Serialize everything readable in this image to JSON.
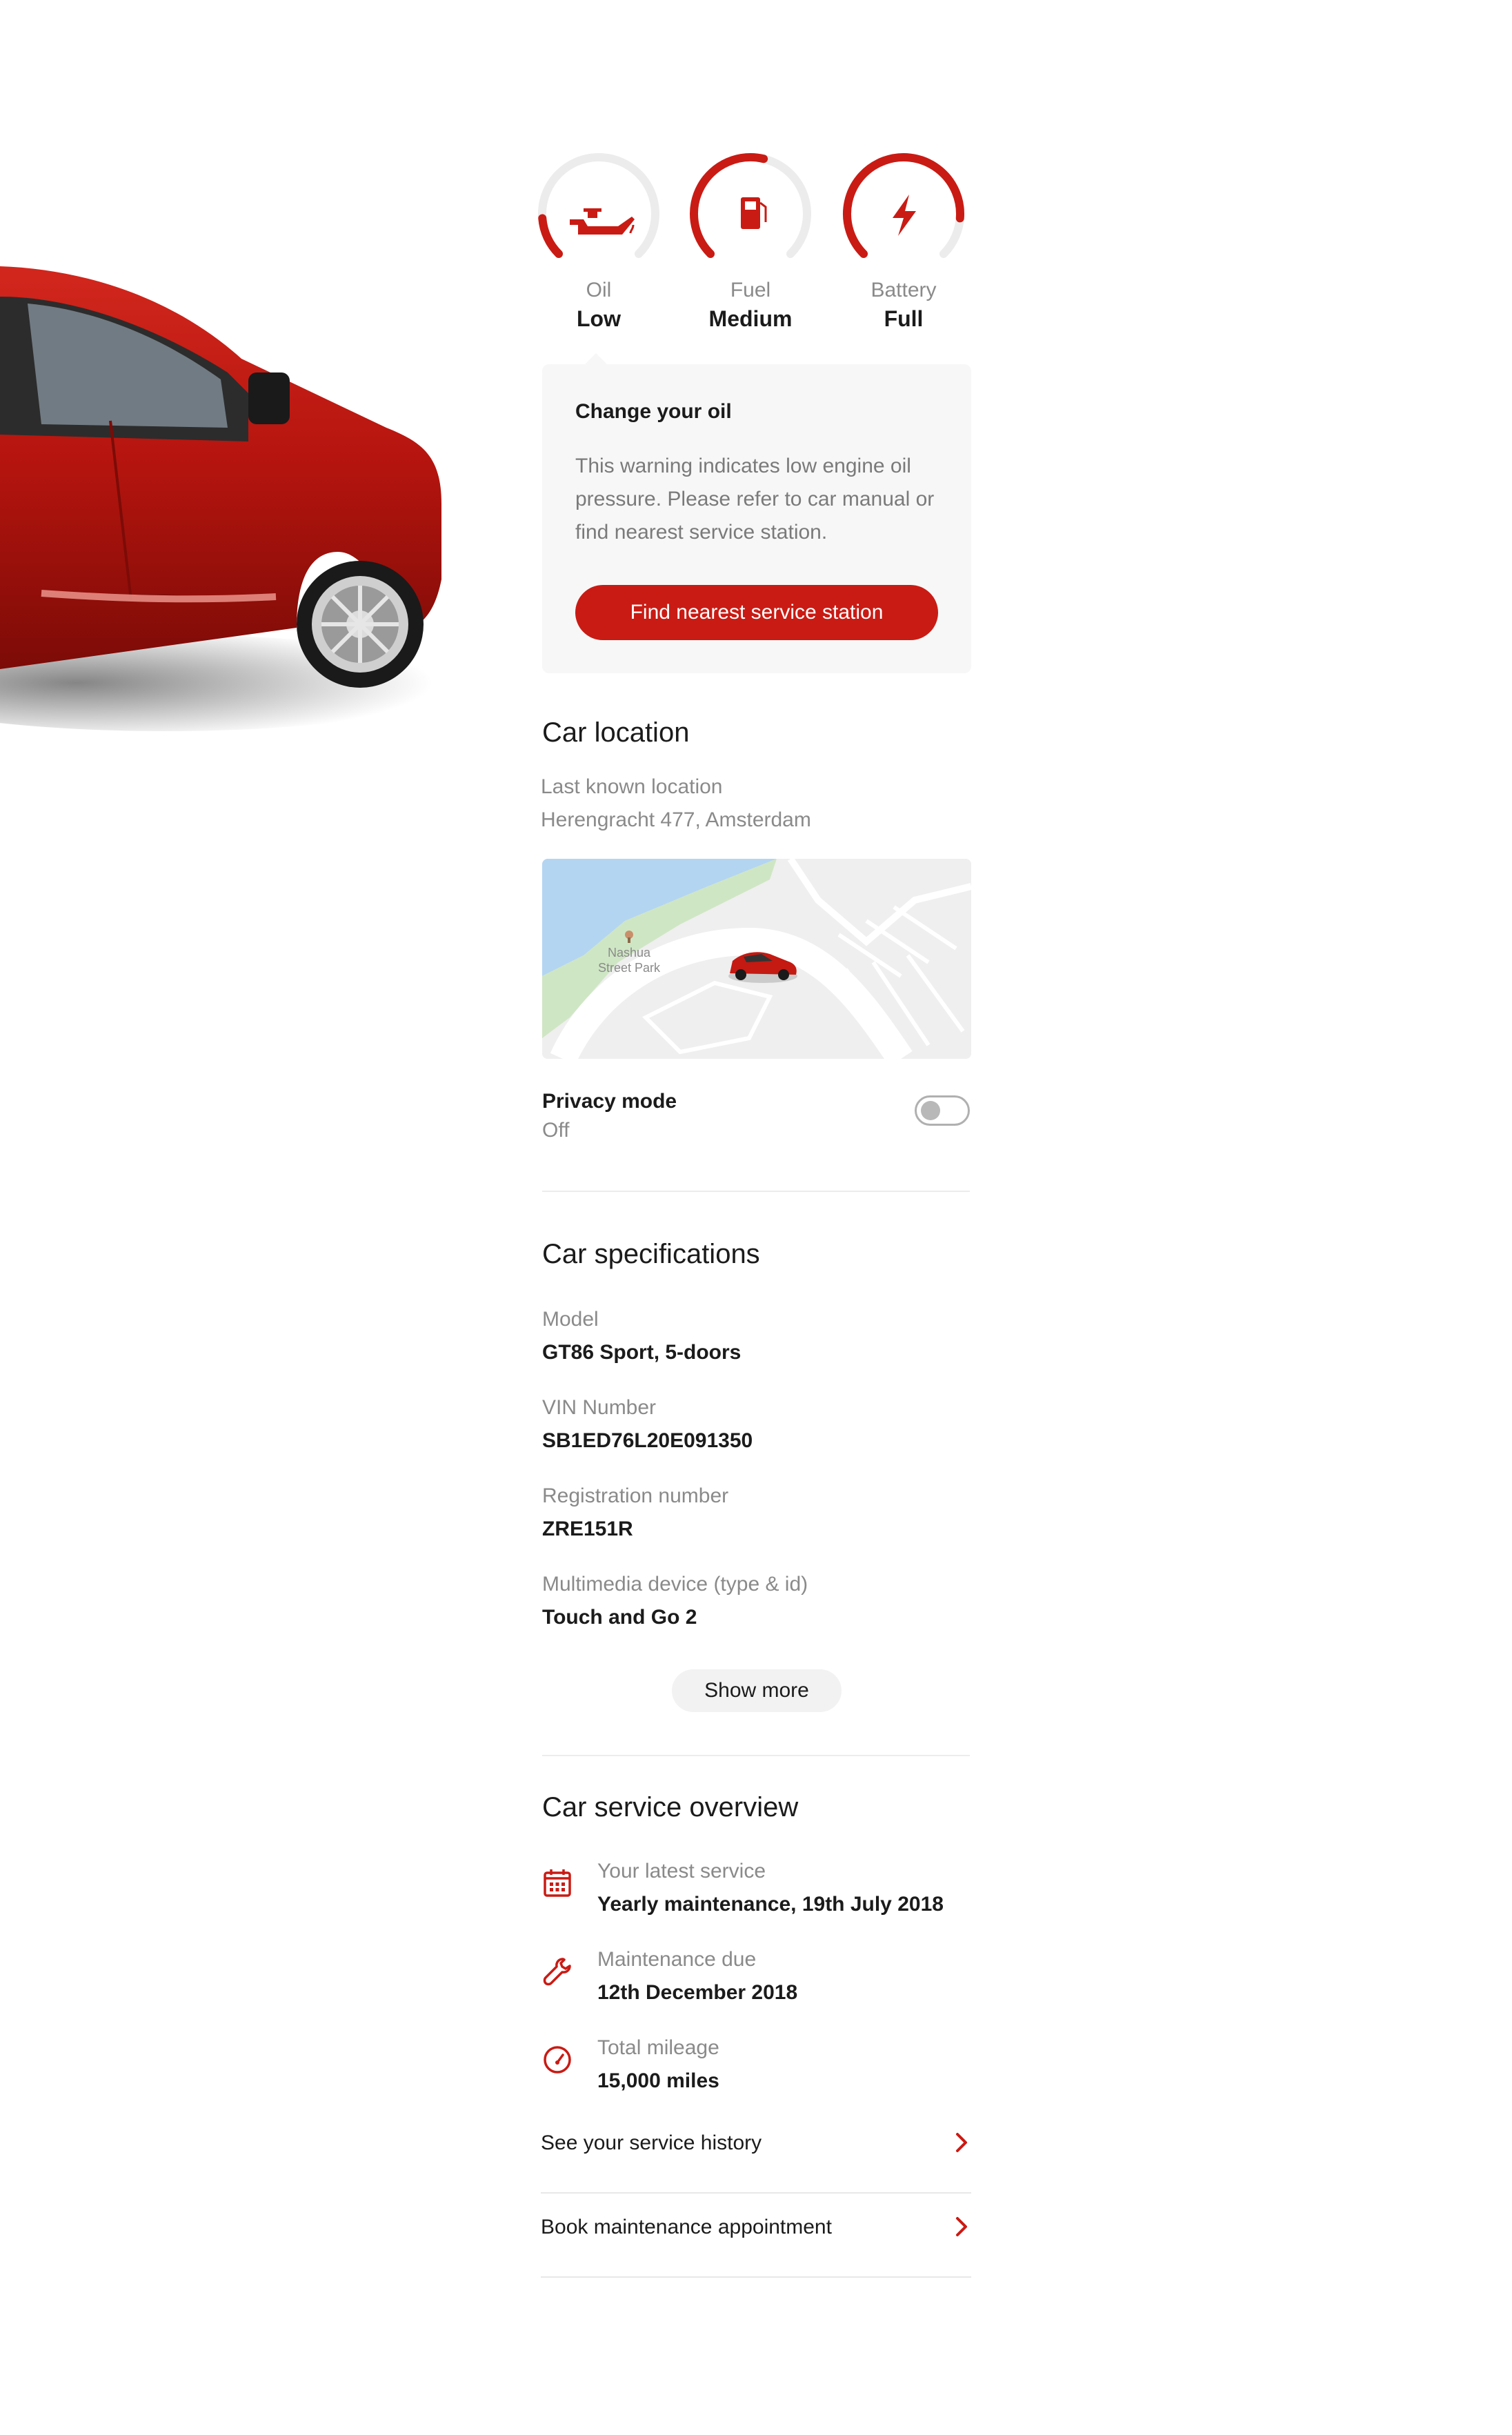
{
  "gauges": [
    {
      "id": "oil",
      "label": "Oil",
      "value": "Low",
      "level": 0.15,
      "icon": "oil-can-icon"
    },
    {
      "id": "fuel",
      "label": "Fuel",
      "value": "Medium",
      "level": 0.55,
      "icon": "fuel-pump-icon"
    },
    {
      "id": "battery",
      "label": "Battery",
      "value": "Full",
      "level": 0.85,
      "icon": "lightning-bolt-icon"
    }
  ],
  "warning": {
    "title": "Change your oil",
    "body": "This warning indicates low engine oil pressure. Please refer to car manual or find nearest service station.",
    "cta": "Find nearest service station"
  },
  "location": {
    "title": "Car location",
    "caption": "Last known location",
    "address": "Herengracht 477, Amsterdam",
    "map_label_line1": "Nashua",
    "map_label_line2": "Street Park"
  },
  "privacy": {
    "label": "Privacy mode",
    "state": "Off",
    "enabled": false
  },
  "specs": {
    "title": "Car specifications",
    "items": [
      {
        "label": "Model",
        "value": "GT86 Sport, 5-doors"
      },
      {
        "label": "VIN Number",
        "value": "SB1ED76L20E091350"
      },
      {
        "label": "Registration number",
        "value": "ZRE151R"
      },
      {
        "label": "Multimedia device (type & id)",
        "value": "Touch and Go 2"
      }
    ],
    "show_more": "Show more"
  },
  "service": {
    "title": "Car service overview",
    "items": [
      {
        "label": "Your latest service",
        "value": "Yearly maintenance, 19th July 2018",
        "icon": "calendar-icon"
      },
      {
        "label": "Maintenance due",
        "value": "12th December 2018",
        "icon": "wrench-icon"
      },
      {
        "label": "Total mileage",
        "value": "15,000 miles",
        "icon": "speedometer-icon"
      }
    ],
    "links": [
      {
        "label": "See your service history"
      },
      {
        "label": "Book maintenance appointment"
      }
    ]
  },
  "colors": {
    "accent": "#c91b14",
    "track": "#ececec",
    "map_water": "#b3d5f2",
    "map_park": "#cfe6c4"
  }
}
